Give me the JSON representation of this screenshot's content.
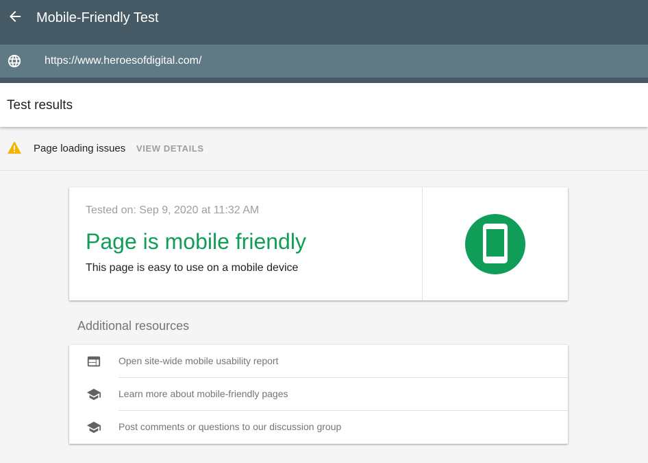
{
  "app": {
    "title": "Mobile-Friendly Test",
    "back_icon": "arrow-back-icon"
  },
  "url_bar": {
    "icon": "globe-icon",
    "url": "https://www.heroesofdigital.com/"
  },
  "results": {
    "title": "Test results"
  },
  "issues": {
    "icon": "warning-icon",
    "text": "Page loading issues",
    "action": "VIEW DETAILS"
  },
  "result_card": {
    "tested_on": "Tested on: Sep 9, 2020 at 11:32 AM",
    "verdict": "Page is mobile friendly",
    "description": "This page is easy to use on a mobile device",
    "badge_icon": "smartphone-icon"
  },
  "resources": {
    "heading": "Additional resources",
    "items": [
      {
        "label": "Open site-wide mobile usability report",
        "icon": "web-layout-icon"
      },
      {
        "label": "Learn more about mobile-friendly pages",
        "icon": "school-icon"
      },
      {
        "label": "Post comments or questions to our discussion group",
        "icon": "school-icon"
      }
    ]
  },
  "colors": {
    "app_bar": "#455a64",
    "url_bar": "#5f7a84",
    "success_green": "#0f9d58",
    "warning_yellow": "#f4b400"
  }
}
